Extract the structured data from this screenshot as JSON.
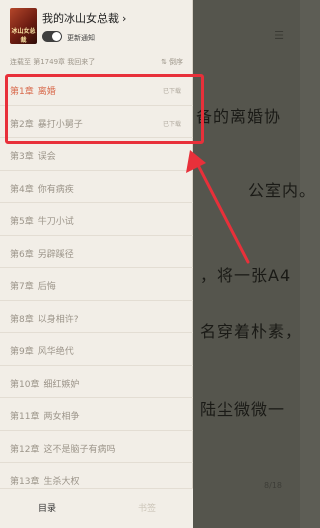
{
  "reader": {
    "lines": [
      "备的离婚协",
      "公室内。",
      "，将一张A4",
      "名穿着朴素，",
      "陆尘微微一"
    ],
    "page_number": "8/18"
  },
  "book": {
    "title": "我的冰山女总裁",
    "cover_text": "冰山女总裁",
    "notify_label": "更新通知",
    "status": "连载至 第1749章 我回来了",
    "sort_label": "倒序"
  },
  "chapters": [
    {
      "num": "第1章",
      "title": "离婚",
      "status": "已下载"
    },
    {
      "num": "第2章",
      "title": "暴打小舅子",
      "status": "已下载"
    },
    {
      "num": "第3章",
      "title": "误会",
      "status": ""
    },
    {
      "num": "第4章",
      "title": "你有病疾",
      "status": ""
    },
    {
      "num": "第5章",
      "title": "牛刀小试",
      "status": ""
    },
    {
      "num": "第6章",
      "title": "另辟蹊径",
      "status": ""
    },
    {
      "num": "第7章",
      "title": "后悔",
      "status": ""
    },
    {
      "num": "第8章",
      "title": "以身相许?",
      "status": ""
    },
    {
      "num": "第9章",
      "title": "风华绝代",
      "status": ""
    },
    {
      "num": "第10章",
      "title": "细红嫉妒",
      "status": ""
    },
    {
      "num": "第11章",
      "title": "两女相争",
      "status": ""
    },
    {
      "num": "第12章",
      "title": "这不是脑子有病吗",
      "status": ""
    },
    {
      "num": "第13章",
      "title": "生杀大权",
      "status": ""
    }
  ],
  "tabs": {
    "toc": "目录",
    "bookmark": "书签"
  },
  "colors": {
    "active_chapter": "#d86a4c",
    "highlight": "#e8303a"
  }
}
